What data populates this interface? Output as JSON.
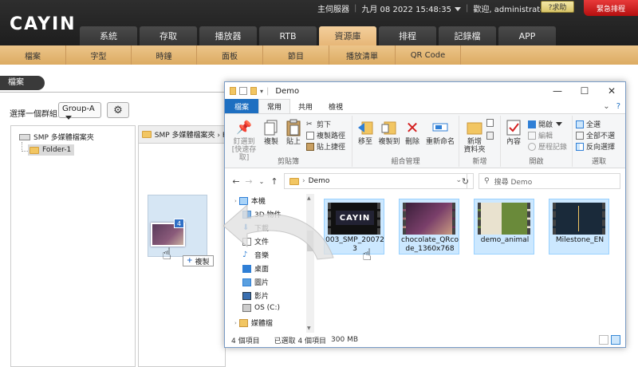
{
  "brand": {
    "logo_text": "CAYIN"
  },
  "status": {
    "server": "主伺服器",
    "datetime": "九月 08 2022 15:48:35",
    "user": "歡迎, administrator",
    "help": "?求助",
    "emergency": "緊急排程"
  },
  "main_tabs": [
    {
      "label": "系統"
    },
    {
      "label": "存取"
    },
    {
      "label": "播放器"
    },
    {
      "label": "RTB"
    },
    {
      "label": "資源庫",
      "active": true
    },
    {
      "label": "排程"
    },
    {
      "label": "記錄檔"
    },
    {
      "label": "APP"
    }
  ],
  "sub_nav": [
    {
      "label": "檔案"
    },
    {
      "label": "字型"
    },
    {
      "label": "時鐘"
    },
    {
      "label": "面板"
    },
    {
      "label": "節目"
    },
    {
      "label": "播放清單"
    },
    {
      "label": "QR Code"
    }
  ],
  "page": {
    "title": "檔案",
    "group_label": "選擇一個群組:",
    "group_value": "Group-A"
  },
  "tree": {
    "root": "SMP 多媒體檔案夾",
    "folder": "Folder-1"
  },
  "content_path": "SMP 多媒體檔案夾 › F",
  "drag": {
    "count": "4",
    "copy_label": "複製"
  },
  "explorer": {
    "title": "Demo",
    "ribbon_tabs": [
      {
        "label": "檔案",
        "style": "file"
      },
      {
        "label": "常用",
        "style": "active"
      },
      {
        "label": "共用",
        "style": ""
      },
      {
        "label": "檢視",
        "style": ""
      }
    ],
    "clipboard": {
      "pin": "釘選到 [快速存取]",
      "copy": "複製",
      "paste": "貼上",
      "cut": "剪下",
      "copy_path": "複製路徑",
      "paste_shortcut": "貼上捷徑",
      "label": "剪貼簿"
    },
    "organize": {
      "move_to": "移至",
      "copy_to": "複製到",
      "delete": "刪除",
      "rename": "重新命名",
      "label": "組合管理"
    },
    "new": {
      "new_folder": "新增\n資料夾",
      "label": "新增"
    },
    "open": {
      "properties": "內容",
      "open": "開啟",
      "edit": "編輯",
      "history": "歷程記錄",
      "label": "開啟"
    },
    "select": {
      "select_all": "全選",
      "select_none": "全部不選",
      "invert": "反向選擇",
      "label": "選取"
    },
    "address": "Demo",
    "search_placeholder": "搜尋 Demo",
    "nav_items": [
      {
        "label": "本機",
        "icon": "pc-icon"
      },
      {
        "label": "3D 物件",
        "icon": "cube-icon"
      },
      {
        "label": "下載",
        "icon": "download-icon"
      },
      {
        "label": "文件",
        "icon": "document-icon"
      },
      {
        "label": "音樂",
        "icon": "music-icon"
      },
      {
        "label": "桌面",
        "icon": "desktop-icon"
      },
      {
        "label": "圖片",
        "icon": "pictures-icon"
      },
      {
        "label": "影片",
        "icon": "videos-icon"
      },
      {
        "label": "OS (C:)",
        "icon": "drive-icon"
      },
      {
        "label": "媒體檔",
        "icon": "folder-icon"
      }
    ],
    "files": [
      {
        "name": "003_SMP_200723",
        "thumb": "cayin"
      },
      {
        "name": "chocolate_QRcode_1360x768",
        "thumb": "chocolate"
      },
      {
        "name": "demo_animal",
        "thumb": "animal"
      },
      {
        "name": "Milestone_EN",
        "thumb": "milestone"
      }
    ],
    "status": {
      "count": "4 個項目",
      "selected": "已選取 4 個項目",
      "size": "300 MB"
    }
  },
  "colors": {
    "active_tab": "#e7b777",
    "subnav": "#dcab62",
    "file_tab": "#1e6fc1",
    "selection": "#cce8ff"
  }
}
